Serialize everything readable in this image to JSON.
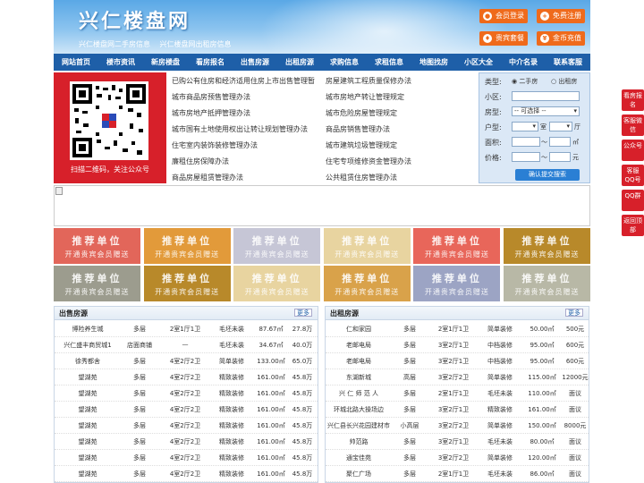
{
  "header": {
    "title": "兴仁楼盘网",
    "subtitle": "兴仁楼盘网二手房信息  兴仁楼盘网出租房信息",
    "buttons": [
      {
        "label": "会员登录",
        "icon": "user-icon"
      },
      {
        "label": "免费注册",
        "icon": "user-add-icon"
      },
      {
        "label": "贵宾套餐",
        "icon": "gift-icon"
      },
      {
        "label": "金币充值",
        "icon": "coin-icon"
      }
    ]
  },
  "nav": [
    "网站首页",
    "楼市资讯",
    "新房楼盘",
    "看房报名",
    "出售房源",
    "出租房源",
    "求购信息",
    "求租信息",
    "地图找房",
    "小区大全",
    "中介名录",
    "联系客服"
  ],
  "qr": {
    "caption": "扫描二维码，关注公众号"
  },
  "links": {
    "left": [
      "已购公有住房和经济适用住房上市出售管理暂",
      "城市商品房预售管理办法",
      "城市房地产抵押管理办法",
      "城市国有土地使用权出让转让规划管理办法",
      "住宅室内装饰装修管理办法",
      "廉租住房保障办法",
      "商品房屋租赁管理办法"
    ],
    "right": [
      "房屋建筑工程质量保修办法",
      "城市房地产转让管理规定",
      "城市危险房屋管理规定",
      "商品房销售管理办法",
      "城市建筑垃圾管理规定",
      "住宅专项维修资金管理办法",
      "公共租赁住房管理办法"
    ]
  },
  "search": {
    "type_label": "类型:",
    "type_options": [
      "二手房",
      "出租房"
    ],
    "community_label": "小区:",
    "property_label": "房型:",
    "property_value": "-- 可选择 --",
    "layout_label": "户型:",
    "layout_room": "室",
    "layout_hall": "厅",
    "area_label": "面积:",
    "area_sep": "～",
    "area_unit": "㎡",
    "price_label": "价格:",
    "price_sep": "～",
    "price_unit": "元",
    "submit": "确认提交搜索"
  },
  "ads": {
    "line1": "推荐单位",
    "line2": "开通贵宾会员赠送",
    "colors": [
      "#e2665a",
      "#e29a3a",
      "#c6c6d6",
      "#e8d4a0",
      "#e8665a",
      "#b8892a",
      "#9c9c8e",
      "#b8892a",
      "#e8d4a0",
      "#d9a24a",
      "#9ca4c4",
      "#b8b8a6"
    ]
  },
  "sale": {
    "title": "出售房源",
    "more": "更多",
    "rows": [
      [
        "博险养生城",
        "多层",
        "2室1厅1卫",
        "毛坯未装",
        "87.67㎡",
        "27.8万"
      ],
      [
        "兴仁盛丰商贸城1",
        "店面商铺",
        "—",
        "毛坯未装",
        "34.67㎡",
        "40.0万"
      ],
      [
        "徐秀都舍",
        "多层",
        "4室2厅2卫",
        "简单装修",
        "133.00㎡",
        "65.0万"
      ],
      [
        "望湖苑",
        "多层",
        "4室2厅2卫",
        "精致装修",
        "161.00㎡",
        "45.8万"
      ],
      [
        "望湖苑",
        "多层",
        "4室2厅2卫",
        "精致装修",
        "161.00㎡",
        "45.8万"
      ],
      [
        "望湖苑",
        "多层",
        "4室2厅2卫",
        "精致装修",
        "161.00㎡",
        "45.8万"
      ],
      [
        "望湖苑",
        "多层",
        "4室2厅2卫",
        "精致装修",
        "161.00㎡",
        "45.8万"
      ],
      [
        "望湖苑",
        "多层",
        "4室2厅2卫",
        "精致装修",
        "161.00㎡",
        "45.8万"
      ],
      [
        "望湖苑",
        "多层",
        "4室2厅2卫",
        "精致装修",
        "161.00㎡",
        "45.8万"
      ],
      [
        "望湖苑",
        "多层",
        "4室2厅2卫",
        "精致装修",
        "161.00㎡",
        "45.8万"
      ]
    ]
  },
  "rent": {
    "title": "出租房源",
    "more": "更多",
    "rows": [
      [
        "仁和家园",
        "多层",
        "2室1厅1卫",
        "简单装修",
        "50.00㎡",
        "500元"
      ],
      [
        "老邮电局",
        "多层",
        "3室2厅1卫",
        "中档装修",
        "95.00㎡",
        "600元"
      ],
      [
        "老邮电局",
        "多层",
        "3室2厅1卫",
        "中档装修",
        "95.00㎡",
        "600元"
      ],
      [
        "东湖新城",
        "高层",
        "3室2厅2卫",
        "简单装修",
        "115.00㎡",
        "12000元"
      ],
      [
        "兴 仁 师 范 人",
        "多层",
        "2室1厅1卫",
        "毛坯未装",
        "110.00㎡",
        "面议"
      ],
      [
        "环城北路大操场边",
        "多层",
        "3室2厅1卫",
        "精致装修",
        "161.00㎡",
        "面议"
      ],
      [
        "兴仁县长兴花园建材市",
        "小高层",
        "3室2厅2卫",
        "简单装修",
        "150.00㎡",
        "8000元"
      ],
      [
        "帅范路",
        "多层",
        "3室2厅1卫",
        "毛坯未装",
        "80.00㎡",
        "面议"
      ],
      [
        "通宝佳苑",
        "多层",
        "3室2厅2卫",
        "简单装修",
        "120.00㎡",
        "面议"
      ],
      [
        "聚仁广场",
        "多层",
        "2室1厅1卫",
        "毛坯未装",
        "86.00㎡",
        "面议"
      ]
    ]
  },
  "sidebar": [
    "看房报名",
    "客服微信",
    "公众号",
    "客服QQ号",
    "QQ群",
    "返回顶部"
  ]
}
